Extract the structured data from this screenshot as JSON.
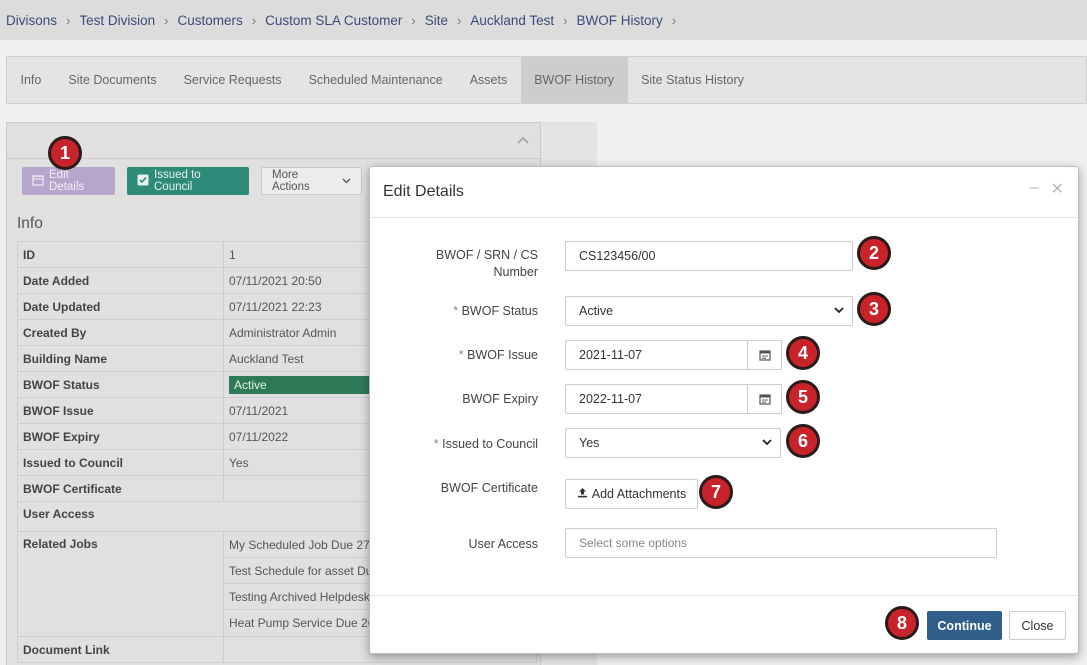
{
  "breadcrumb": [
    "Divisons",
    "Test Division",
    "Customers",
    "Custom SLA Customer",
    "Site",
    "Auckland Test",
    "BWOF History"
  ],
  "tabs": [
    {
      "label": "Info"
    },
    {
      "label": "Site Documents"
    },
    {
      "label": "Service Requests"
    },
    {
      "label": "Scheduled Maintenance"
    },
    {
      "label": "Assets"
    },
    {
      "label": "BWOF History",
      "active": true
    },
    {
      "label": "Site Status History"
    }
  ],
  "toolbar": {
    "edit_label": "Edit Details",
    "issued_label": "Issued to Council",
    "more_label": "More Actions"
  },
  "info": {
    "title": "Info",
    "rows": [
      {
        "key": "ID",
        "value": "1"
      },
      {
        "key": "Date Added",
        "value": "07/11/2021 20:50"
      },
      {
        "key": "Date Updated",
        "value": "07/11/2021 22:23"
      },
      {
        "key": "Created By",
        "value": "Administrator Admin"
      },
      {
        "key": "Building Name",
        "value": "Auckland Test"
      },
      {
        "key": "BWOF Status",
        "value": "Active"
      },
      {
        "key": "BWOF Issue",
        "value": "07/11/2021"
      },
      {
        "key": "BWOF Expiry",
        "value": "07/11/2022"
      },
      {
        "key": "Issued to Council",
        "value": "Yes"
      },
      {
        "key": "BWOF Certificate",
        "value": ""
      },
      {
        "key": "User Access",
        "value": ""
      }
    ],
    "related_jobs_label": "Related Jobs",
    "related_jobs": [
      "My Scheduled Job Due 27/",
      "Test Schedule for asset Du",
      "Testing Archived Helpdesk",
      "Heat Pump Service Due 26"
    ],
    "document_link_label": "Document Link"
  },
  "modal": {
    "title": "Edit Details",
    "fields": {
      "bwof_number_label": "BWOF / SRN / CS Number",
      "bwof_number_value": "CS123456/00",
      "status_label": "BWOF Status",
      "status_value": "Active",
      "issue_label": "BWOF Issue",
      "issue_value": "2021-11-07",
      "expiry_label": "BWOF Expiry",
      "expiry_value": "2022-11-07",
      "council_label": "Issued to Council",
      "council_value": "Yes",
      "certificate_label": "BWOF Certificate",
      "attach_label": "Add Attachments",
      "access_label": "User Access",
      "access_placeholder": "Select some options"
    },
    "continue_label": "Continue",
    "close_label": "Close"
  },
  "callouts": [
    "1",
    "2",
    "3",
    "4",
    "5",
    "6",
    "7",
    "8"
  ],
  "colors": {
    "primary": "#2f5f8a",
    "teal": "#2e8a79",
    "purple": "#b7a5cc",
    "badge": "#c8222a",
    "status_active": "#2e7a57"
  }
}
